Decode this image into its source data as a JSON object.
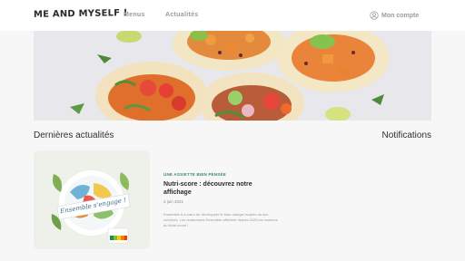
{
  "header": {
    "brand": "ME AND MYSELF !",
    "nav": [
      {
        "label": "Menus"
      },
      {
        "label": "Actualités"
      }
    ],
    "account_label": "Mon compte"
  },
  "sections": {
    "latest_title": "Dernières actualités",
    "notifications_title": "Notifications"
  },
  "article": {
    "category": "UNE ASSIETTE BIEN PENSÉE",
    "title": "Nutri-score : découvrez notre affichage",
    "date": "2 juin 2021",
    "excerpt": "Ensemble à à cœur de développer le bien-manger auprès de ses convives. Les restaurants Ensemble affichent depuis 2020 les couleurs du Nutri-score !",
    "image_badge_text": "Ensemble s'engage !"
  },
  "colors": {
    "accent_green": "#3a8a6e",
    "nav_gray": "#9b9b9b",
    "background": "#f7f7f7"
  },
  "icons": {
    "account": "user-circle-icon"
  }
}
